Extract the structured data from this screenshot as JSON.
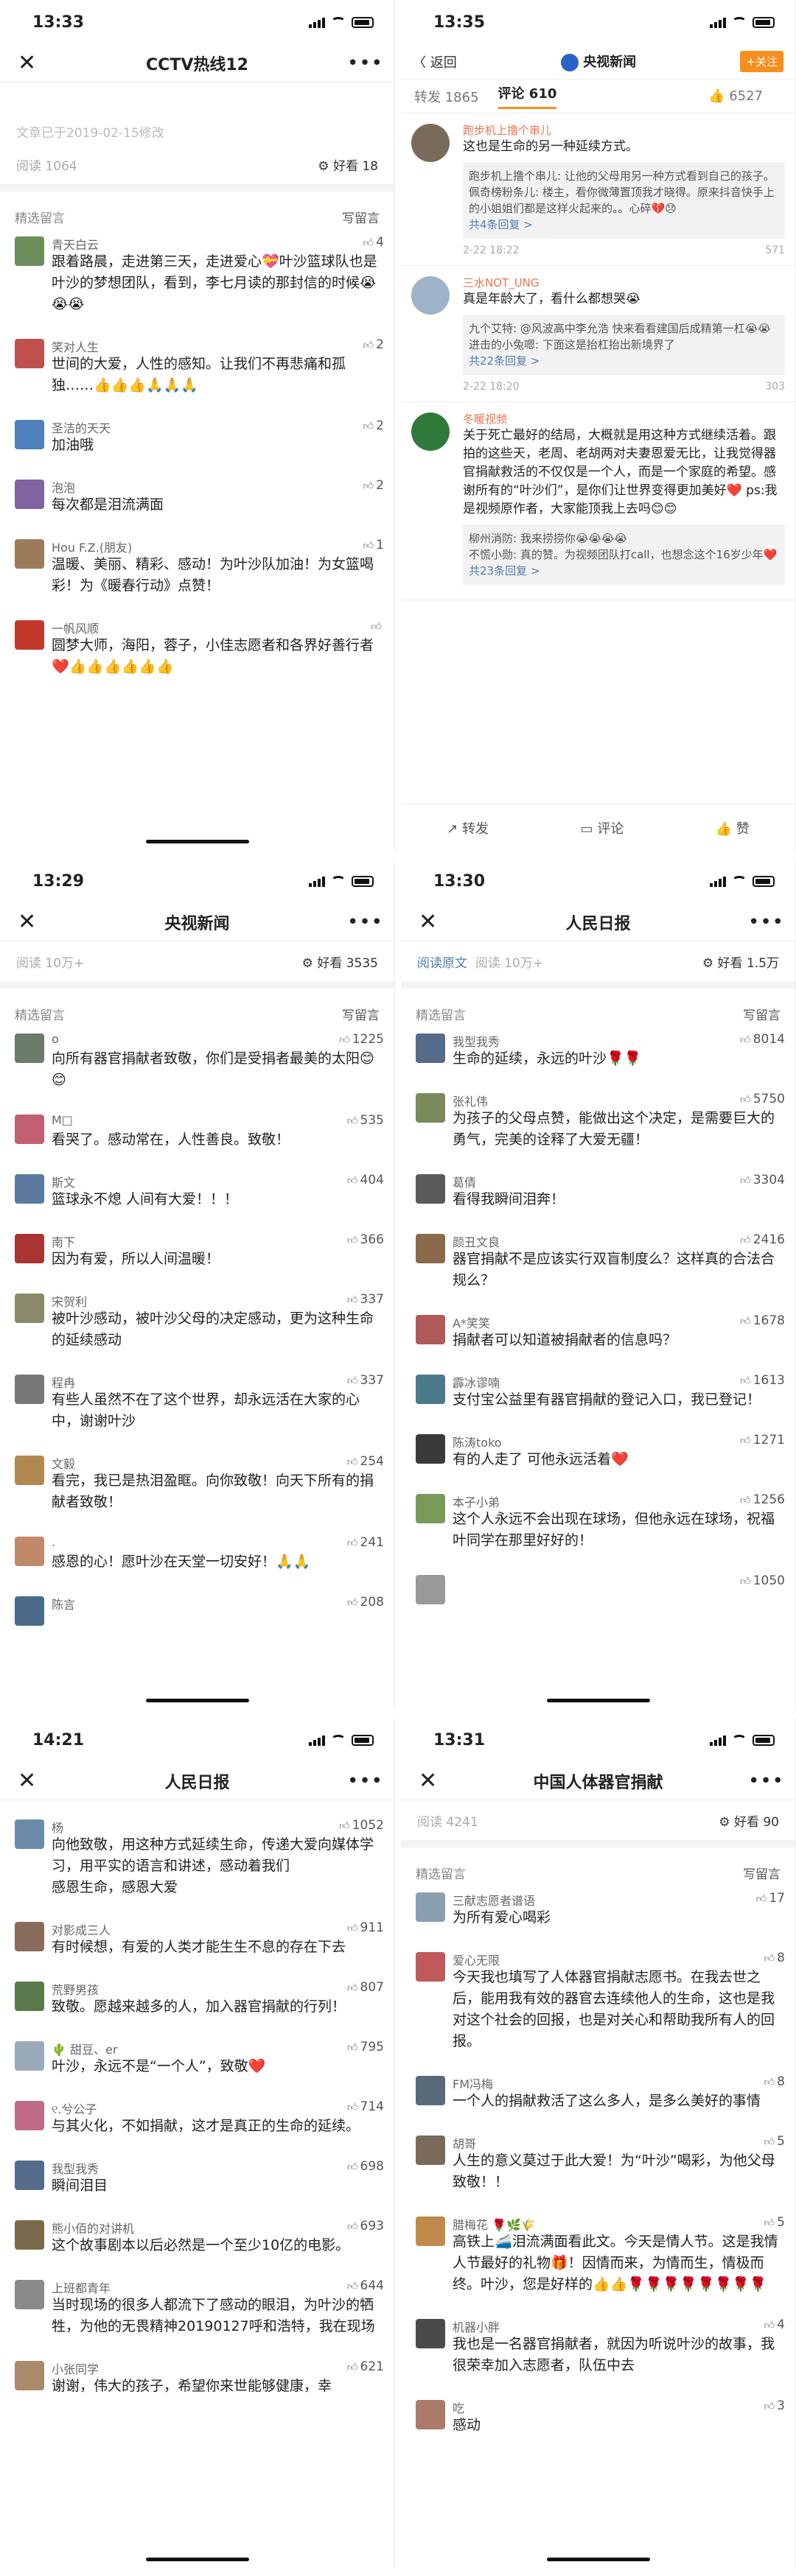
{
  "p1": {
    "time": "13:33",
    "title": "CCTV热线12",
    "modified": "文章已于2019-02-15修改",
    "reads": "阅读 1064",
    "good": "好看 18",
    "section": "精选留言",
    "write": "写留言",
    "comments": [
      {
        "name": "青天白云",
        "likes": "4",
        "text": "跟着路晨，走进第三天，走进爱心💝叶沙篮球队也是叶沙的梦想团队，看到，李七月读的那封信的时候😭😭😭",
        "color": "#6b8e5a"
      },
      {
        "name": "笑对人生",
        "likes": "2",
        "text": "世间的大爱，人性的感知。让我们不再悲痛和孤独……👍👍👍🙏🙏🙏",
        "color": "#c0504d"
      },
      {
        "name": "圣洁的天天",
        "likes": "2",
        "text": "加油哦",
        "color": "#4f81bd"
      },
      {
        "name": "泡泡",
        "likes": "2",
        "text": "每次都是泪流满面",
        "color": "#8064a2"
      },
      {
        "name": "Hou F.Z.(朋友)",
        "likes": "1",
        "text": "温暖、美丽、精彩、感动！为叶沙队加油！为女篮喝彩！为《暖春行动》点赞！",
        "color": "#9b7b5a"
      },
      {
        "name": "一帆风顺",
        "likes": "",
        "text": "圆梦大师，海阳，蓉子，小佳志愿者和各界好善行者❤️👍👍👍👍👍👍",
        "color": "#c0392b"
      }
    ]
  },
  "p2": {
    "time": "13:35",
    "back": "返回",
    "account": "央视新闻",
    "follow": "+关注",
    "tab_repost": "转发 1865",
    "tab_comment": "评论 610",
    "tab_like": "6527",
    "comments": [
      {
        "name": "跑步机上撸个串儿",
        "text": "这也是生命的另一种延续方式。",
        "reply1": "跑步机上撸个串儿: 让他的父母用另一种方式看到自己的孩子。",
        "reply2": "佩奇榜粉条儿: 楼主，看你微薄置顶我才晓得。原来抖音快手上的小姐姐们都是这样火起来的。。心碎💔😞",
        "more": "共4条回复 >",
        "date": "2-22 18:22",
        "likes": "571",
        "color": "#7a6a5a"
      },
      {
        "name": "三水NOT_UNG",
        "text": "真是年龄大了，看什么都想哭😭",
        "reply1": "九个艾特: @风波高中李允浩 快来看看建国后成精第一杠😭😭",
        "reply2": "进击的小兔嗯: 下面这是抬杠抬出新境界了",
        "more": "共22条回复 >",
        "date": "2-22 18:20",
        "likes": "303",
        "color": "#9db3c9"
      },
      {
        "name": "冬暖视频",
        "text": "关于死亡最好的结局，大概就是用这种方式继续活着。跟拍的这些天，老周、老胡两对夫妻恩爱无比，让我觉得器官捐献救活的不仅仅是一个人，而是一个家庭的希望。感谢所有的“叶沙们”，是你们让世界变得更加美好❤️ ps:我是视频原作者，大家能顶我上去吗😊😊",
        "reply1": "柳州消防: 我来捞捞你😭😭😭😭",
        "reply2": "不慌小勋: 真的赞。为视频团队打call，也想念这个16岁少年❤️",
        "more": "共23条回复 >",
        "date": "",
        "likes": "",
        "color": "#2f7a3a"
      }
    ],
    "act_repost": "转发",
    "act_comment": "评论",
    "act_like": "赞"
  },
  "p3": {
    "time": "13:29",
    "title": "央视新闻",
    "reads": "阅读 10万+",
    "good": "好看 3535",
    "section": "精选留言",
    "write": "写留言",
    "comments": [
      {
        "name": "o",
        "likes": "1225",
        "text": "向所有器官捐献者致敬，你们是受捐者最美的太阳😊😊",
        "color": "#6a7b6a"
      },
      {
        "name": "M□",
        "likes": "535",
        "text": "看哭了。感动常在，人性善良。致敬！",
        "color": "#c06070"
      },
      {
        "name": "斯文",
        "likes": "404",
        "text": "篮球永不熄 人间有大爱！！！",
        "color": "#5a7aa0"
      },
      {
        "name": "南下",
        "likes": "366",
        "text": "因为有爱，所以人间温暖！",
        "color": "#aa3333"
      },
      {
        "name": "宋贺利",
        "likes": "337",
        "text": "被叶沙感动，被叶沙父母的决定感动，更为这种生命的延续感动",
        "color": "#8a8a6a"
      },
      {
        "name": "程冉",
        "likes": "337",
        "text": "有些人虽然不在了这个世界，却永远活在大家的心中，谢谢叶沙",
        "color": "#777"
      },
      {
        "name": "文毅",
        "likes": "254",
        "text": "看完，我已是热泪盈眶。向你致敬！向天下所有的捐献者致敬！",
        "color": "#b08850"
      },
      {
        "name": ".",
        "likes": "241",
        "text": "感恩的心！愿叶沙在天堂一切安好！🙏🙏",
        "color": "#c08a6a"
      },
      {
        "name": "陈言",
        "likes": "208",
        "text": "",
        "color": "#4a6a8a"
      }
    ]
  },
  "p4": {
    "time": "13:30",
    "title": "人民日报",
    "orig": "阅读原文",
    "reads": "阅读 10万+",
    "good": "好看 1.5万",
    "section": "精选留言",
    "write": "写留言",
    "comments": [
      {
        "name": "我型我秀",
        "likes": "8014",
        "text": "生命的延续，永远的叶沙🌹🌹",
        "color": "#556b8a"
      },
      {
        "name": "张礼伟",
        "likes": "5750",
        "text": "为孩子的父母点赞，能做出这个决定，是需要巨大的勇气，完美的诠释了大爱无疆！",
        "color": "#7a8a5a"
      },
      {
        "name": "葛倩",
        "likes": "3304",
        "text": "看得我瞬间泪奔！",
        "color": "#5a5a5a"
      },
      {
        "name": "颜丑文良",
        "likes": "2416",
        "text": "器官捐献不是应该实行双盲制度么？这样真的合法合规么？",
        "color": "#8a6a4a"
      },
      {
        "name": "A*笑笑",
        "likes": "1678",
        "text": "捐献者可以知道被捐献者的信息吗？",
        "color": "#b05a5a"
      },
      {
        "name": "霹冰谬喃",
        "likes": "1613",
        "text": "支付宝公益里有器官捐献的登记入口，我已登记！",
        "color": "#4a7a8a"
      },
      {
        "name": "陈涛toko",
        "likes": "1271",
        "text": "有的人走了 可他永远活着❤️",
        "color": "#3a3a3a"
      },
      {
        "name": "本子小弟",
        "likes": "1256",
        "text": "这个人永远不会出现在球场，但他永远在球场，祝福叶同学在那里好好的！",
        "color": "#7a9a5a"
      },
      {
        "name": "",
        "likes": "1050",
        "text": "",
        "color": "#999"
      }
    ]
  },
  "p5": {
    "time": "14:21",
    "title": "人民日报",
    "comments": [
      {
        "name": "杨",
        "likes": "1052",
        "text": "向他致敬，用这种方式延续生命，传递大爱向媒体学习，用平实的语言和讲述，感动着我们\n感恩生命，感恩大爱",
        "color": "#6a8aaa"
      },
      {
        "name": "对影成三人",
        "likes": "911",
        "text": "有时候想，有爱的人类才能生生不息的存在下去",
        "color": "#8a6a5a"
      },
      {
        "name": "荒野男孩",
        "likes": "807",
        "text": "致敬。愿越来越多的人，加入器官捐献的行列！",
        "color": "#5a7a4a"
      },
      {
        "name": "🌵 甜豆、er",
        "likes": "795",
        "text": "叶沙，永远不是“一个人”，致敬❤️",
        "color": "#9aaabb"
      },
      {
        "name": "୧.兮公子",
        "likes": "714",
        "text": "与其火化，不如捐献，这才是真正的生命的延续。",
        "color": "#c06a8a"
      },
      {
        "name": "我型我秀",
        "likes": "698",
        "text": "瞬间泪目",
        "color": "#556b8a"
      },
      {
        "name": "熊小佰的对讲机",
        "likes": "693",
        "text": "这个故事剧本以后必然是一个至少10亿的电影。",
        "color": "#7a6a4a"
      },
      {
        "name": "上班都青年",
        "likes": "644",
        "text": "当时现场的很多人都流下了感动的眼泪，为叶沙的牺牲，为他的无畏精神20190127呼和浩特，我在现场",
        "color": "#8a8a8a"
      },
      {
        "name": "小张同学",
        "likes": "621",
        "text": "谢谢，伟大的孩子，希望你来世能够健康，幸",
        "color": "#aa8a6a"
      }
    ]
  },
  "p6": {
    "time": "13:31",
    "title": "中国人体器官捐献",
    "reads": "阅读 4241",
    "good": "好看 90",
    "section": "精选留言",
    "write": "写留言",
    "comments": [
      {
        "name": "三献志愿者谱语",
        "likes": "17",
        "text": "为所有爱心喝彩",
        "color": "#8aa0b0"
      },
      {
        "name": "爱心无限",
        "likes": "8",
        "text": "今天我也填写了人体器官捐献志愿书。在我去世之后，能用我有效的器官去连续他人的生命，这也是我对这个社会的回报，也是对关心和帮助我所有人的回报。",
        "color": "#c05a5a"
      },
      {
        "name": "FM冯梅",
        "likes": "8",
        "text": "一个人的捐献救活了这么多人，是多么美好的事情",
        "color": "#5a6a7a"
      },
      {
        "name": "胡哥",
        "likes": "5",
        "text": "人生的意义莫过于此大爱！为“叶沙”喝彩，为他父母致敬！！",
        "color": "#7a6a5a"
      },
      {
        "name": "腊梅花 🌹🌿🌾",
        "likes": "5",
        "text": "高铁上🚄泪流满面看此文。今天是情人节。这是我情人节最好的礼物🎁！因情而来，为情而生，情极而终。叶沙，您是好样的👍👍🌹🌹🌹🌹🌹🌹🌹🌹",
        "color": "#c08a4a"
      },
      {
        "name": "机器小胖",
        "likes": "4",
        "text": "我也是一名器官捐献者，就因为听说叶沙的故事，我很荣幸加入志愿者，队伍中去",
        "color": "#4a4a4a"
      },
      {
        "name": "吃",
        "likes": "3",
        "text": "感动",
        "color": "#aa7a6a"
      }
    ]
  }
}
